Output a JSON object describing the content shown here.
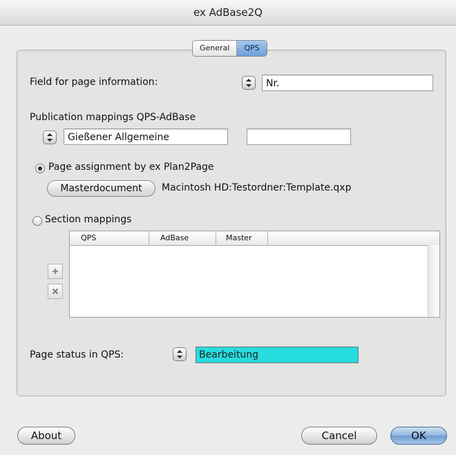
{
  "window": {
    "title": "ex AdBase2Q"
  },
  "tabs": [
    {
      "label": "General",
      "active": false
    },
    {
      "label": "QPS",
      "active": true
    }
  ],
  "page_info": {
    "label": "Field for page information:",
    "value": "Nr."
  },
  "publication": {
    "label": "Publication mappings QPS-AdBase",
    "value": "Gießener Allgemeine",
    "second_value": ""
  },
  "page_assignment": {
    "label": "Page assignment by ex Plan2Page",
    "selected": true,
    "master_button": "Masterdocument",
    "master_path": "Macintosh HD:Testordner:Template.qxp"
  },
  "section": {
    "label": "Section mappings",
    "selected": false,
    "columns": [
      "QPS",
      "AdBase",
      "Master"
    ],
    "rows": []
  },
  "status": {
    "label": "Page status in QPS:",
    "value": "Bearbeitung",
    "highlight": "#27dcdf"
  },
  "buttons": {
    "about": "About",
    "cancel": "Cancel",
    "ok": "OK"
  },
  "icons": {
    "add": "plus-icon",
    "remove": "x-icon",
    "popup": "updown-arrows-icon"
  }
}
